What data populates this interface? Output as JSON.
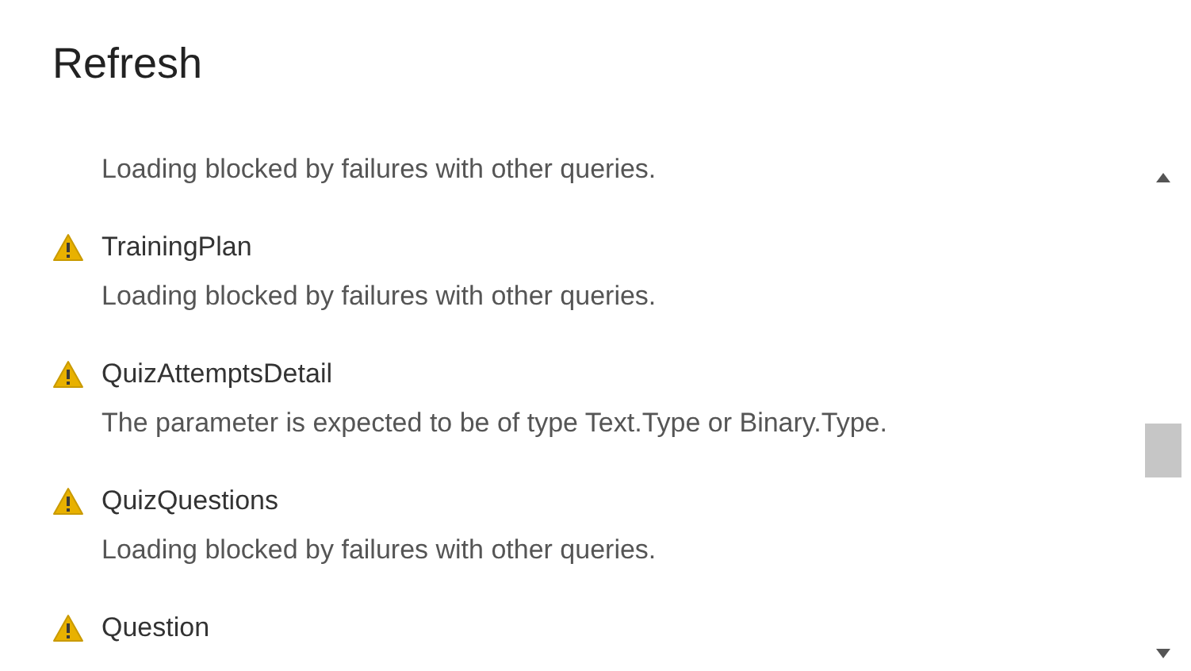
{
  "title": "Refresh",
  "items": [
    {
      "message": "Loading blocked by failures with other queries."
    },
    {
      "name": "TrainingPlan",
      "message": "Loading blocked by failures with other queries."
    },
    {
      "name": "QuizAttemptsDetail",
      "message": "The parameter is expected to be of type Text.Type or Binary.Type."
    },
    {
      "name": "QuizQuestions",
      "message": "Loading blocked by failures with other queries."
    },
    {
      "name": "Question"
    }
  ]
}
